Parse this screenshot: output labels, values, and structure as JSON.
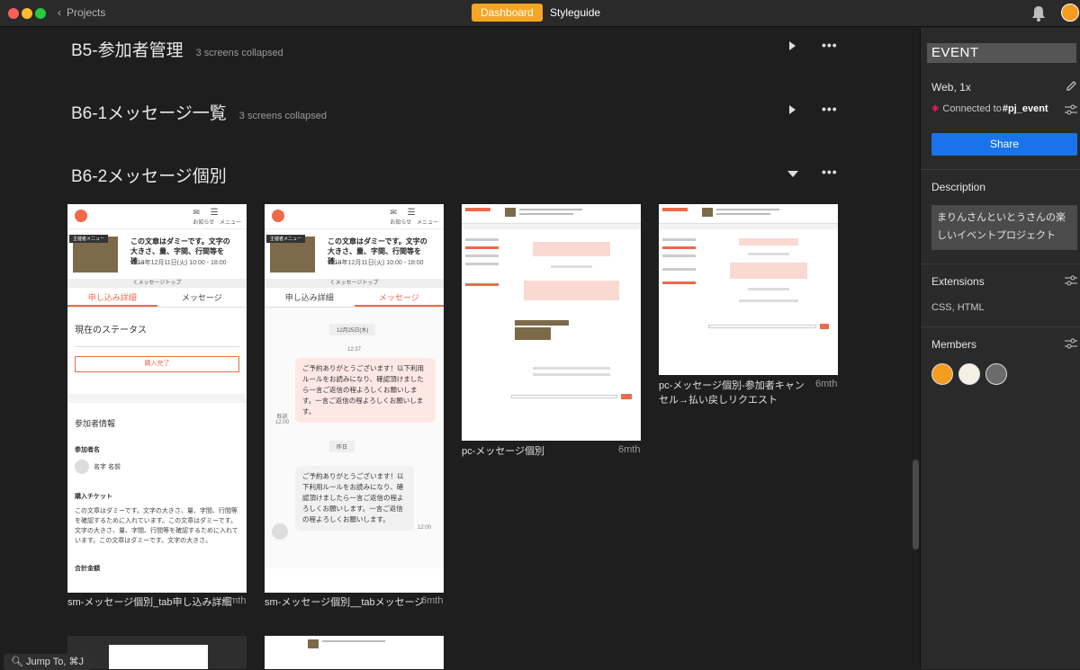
{
  "topbar": {
    "back_label": "Projects",
    "tabs": [
      {
        "label": "Dashboard",
        "active": true
      },
      {
        "label": "Styleguide",
        "active": false
      }
    ],
    "accent": "#f5a623"
  },
  "sections": [
    {
      "title": "B5-参加者管理",
      "count": "3 screens collapsed",
      "state": "collapsed"
    },
    {
      "title": "B6-1メッセージ一覧",
      "count": "3 screens collapsed",
      "state": "collapsed"
    },
    {
      "title": "B6-2メッセージ個別",
      "count": "",
      "state": "expanded"
    }
  ],
  "screens": [
    {
      "name": "sm-メッセージ個別_tab申し込み詳細",
      "age": "6mth"
    },
    {
      "name": "sm-メッセージ個別__tabメッセージ",
      "age": "6mth"
    },
    {
      "name": "pc-メッセージ個別",
      "age": "6mth"
    },
    {
      "name": "pc-メッセージ個別-参加者キャンセル→払い戻しリクエスト",
      "age": "6mth"
    }
  ],
  "mobile": {
    "notify": "お知らせ",
    "menu": "メニュー",
    "host_menu": "主催者メニュー",
    "event_title": "この文章はダミーです。文字の大きさ、量、字間、行間等を確…",
    "event_date": "2018年12月11日(火) 10:00 - 18:00",
    "message_top": "くメッセージトップ",
    "tab_detail": "申し込み詳細",
    "tab_message": "メッセージ",
    "status_heading": "現在のステータス",
    "status_button": "購入完了",
    "participant_heading": "参加者情報",
    "participant_name_label": "参加者名",
    "participant_name": "名字 名前",
    "ticket_label": "購入チケット",
    "ticket_text": "この文章はダミーです。文字の大きさ、量、字間、行間等を確認するために入れています。この文章はダミーです。文字の大きさ、量、字間、行間等を確認するために入れています。この文章はダミーです。文字の大きさ。",
    "total_label": "合計金額",
    "date_pill_1": "12月25日(水)",
    "time_1": "12:37",
    "msg_1": "ご予約ありがとうございます！以下利用ルールをお読みになり、確認頂けましたら一言ご返信の程よろしくお願いします。一言ご返信の程よろしくお願いします。",
    "read_label": "既読",
    "read_time": "12:00",
    "date_pill_2": "昨日",
    "msg_2": "ご予約ありがとうございます！以下利用ルールをお読みになり、確認頂けましたら一言ご返信の程よろしくお願いします。一言ご返信の程よろしくお願いします。",
    "time_2": "12:00"
  },
  "sidebar": {
    "project_title": "EVENT",
    "platform": "Web, 1x",
    "connected_prefix": "Connected to ",
    "connected_channel": "#pj_event",
    "share_label": "Share",
    "description_label": "Description",
    "description_text": "まりんさんといとうさんの楽しいイベントプロジェクト",
    "extensions_label": "Extensions",
    "extensions_value": "CSS, HTML",
    "members_label": "Members"
  },
  "jump_label": "Jump To, ⌘J",
  "colors": {
    "brand_orange": "#ee6a4b",
    "share_blue": "#1a73e8"
  }
}
